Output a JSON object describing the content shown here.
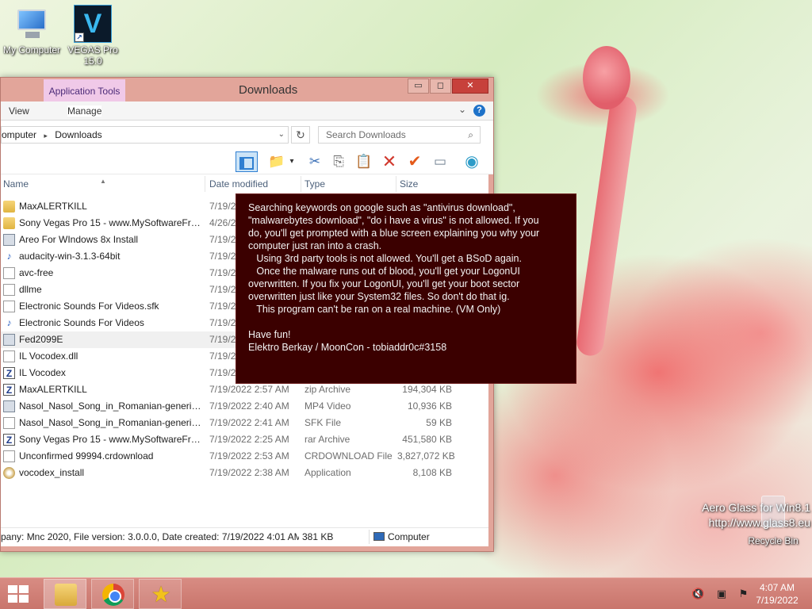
{
  "desktop": {
    "icons": [
      {
        "label": "My Computer",
        "icon": "computer-icon"
      },
      {
        "label": "VEGAS Pro 15.0",
        "icon": "vegas-pro-icon",
        "glyph": "V"
      }
    ],
    "recycle_bin": {
      "label": "Recycle Bin",
      "icon": "recycle-bin-icon"
    },
    "watermark": {
      "line1": "Aero Glass for Win8.1",
      "line2": "http://www.glass8.eu"
    }
  },
  "window": {
    "title": "Downloads",
    "contextual_tab": "Application Tools",
    "ribbon_tabs": [
      "View",
      "Manage"
    ],
    "controls": {
      "minimize": "▭",
      "maximize": "◻",
      "close": "✕"
    },
    "address": {
      "crumbs": [
        "omputer",
        "Downloads"
      ],
      "separator": "▸"
    },
    "search": {
      "placeholder": "Search Downloads"
    },
    "toolbar_icons": [
      "preview-pane-icon",
      "folder-options-icon",
      "cut-icon",
      "copy-icon",
      "paste-icon",
      "delete-icon",
      "properties-icon",
      "rename-icon",
      "globe-icon"
    ],
    "columns": {
      "name": "Name",
      "date": "Date modified",
      "type": "Type",
      "size": "Size"
    },
    "files": [
      {
        "name": "MaxALERTKILL",
        "date": "7/19/2022 2:57 AM",
        "type": "",
        "size": "",
        "icon": "folder"
      },
      {
        "name": "Sony Vegas Pro 15 - www.MySoftwareFre...",
        "date": "4/26/2022",
        "type": "",
        "size": "",
        "icon": "folder"
      },
      {
        "name": "Areo For WIndows 8x Install",
        "date": "7/19/2022",
        "type": "",
        "size": "",
        "icon": "app"
      },
      {
        "name": "audacity-win-3.1.3-64bit",
        "date": "7/19/2022",
        "type": "",
        "size": "",
        "icon": "audio"
      },
      {
        "name": "avc-free",
        "date": "7/19/2022",
        "type": "",
        "size": "",
        "icon": "file"
      },
      {
        "name": "dllme",
        "date": "7/19/2022",
        "type": "",
        "size": "",
        "icon": "file"
      },
      {
        "name": "Electronic Sounds For Videos.sfk",
        "date": "7/19/2022",
        "type": "",
        "size": "",
        "icon": "file"
      },
      {
        "name": "Electronic Sounds For Videos",
        "date": "7/19/2022",
        "type": "",
        "size": "",
        "icon": "audio"
      },
      {
        "name": "Fed2099E",
        "date": "7/19/2022",
        "type": "",
        "size": "",
        "icon": "app",
        "highlight": true
      },
      {
        "name": "IL Vocodex.dll",
        "date": "7/19/2022",
        "type": "",
        "size": "",
        "icon": "file"
      },
      {
        "name": "IL Vocodex",
        "date": "7/19/2022",
        "type": "",
        "size": "",
        "icon": "zip"
      },
      {
        "name": "MaxALERTKILL",
        "date": "7/19/2022 2:57 AM",
        "type": "zip Archive",
        "size": "194,304 KB",
        "icon": "zip"
      },
      {
        "name": "Nasol_Nasol_Song_in_Romanian-generic...",
        "date": "7/19/2022 2:40 AM",
        "type": "MP4 Video",
        "size": "10,936 KB",
        "icon": "app"
      },
      {
        "name": "Nasol_Nasol_Song_in_Romanian-generic...",
        "date": "7/19/2022 2:41 AM",
        "type": "SFK File",
        "size": "59 KB",
        "icon": "file"
      },
      {
        "name": "Sony Vegas Pro 15 - www.MySoftwareFre...",
        "date": "7/19/2022 2:25 AM",
        "type": "rar Archive",
        "size": "451,580 KB",
        "icon": "zip"
      },
      {
        "name": "Unconfirmed 99994.crdownload",
        "date": "7/19/2022 2:53 AM",
        "type": "CRDOWNLOAD File",
        "size": "3,827,072 KB",
        "icon": "file"
      },
      {
        "name": "vocodex_install",
        "date": "7/19/2022 2:38 AM",
        "type": "Application",
        "size": "8,108 KB",
        "icon": "cd"
      }
    ],
    "status": {
      "details": "pany: Mnc 2020, File version: 3.0.0.0, Date created: 7/19/2022 4:01 AM, S",
      "size": "381 KB",
      "zone": "Computer"
    }
  },
  "message": {
    "lines": [
      "Searching keywords on google such as \"antivirus download\",",
      "\"malwarebytes download\", \"do i have a virus\" is not allowed. If you",
      "do, you'll get prompted with a blue screen explaining you why your",
      "computer just ran into a crash.",
      "   Using 3rd party tools is not allowed. You'll get a BSoD again.",
      "   Once the malware runs out of blood, you'll get your LogonUI",
      "overwritten. If you fix your LogonUI, you'll get your boot sector",
      "overwritten just like your System32 files. So don't do that ig.",
      "   This program can't be ran on a real machine. (VM Only)",
      "",
      "Have fun!",
      "Elektro Berkay / MoonCon - tobiaddr0c#3158"
    ]
  },
  "taskbar": {
    "apps": [
      {
        "name": "file-explorer",
        "icon": "folder-icon"
      },
      {
        "name": "chrome",
        "icon": "chrome-icon"
      },
      {
        "name": "favorite-app",
        "icon": "star-icon"
      }
    ],
    "tray_icons": [
      "volume-muted-icon",
      "network-icon",
      "action-center-icon"
    ],
    "time": "4:07 AM",
    "date": "7/19/2022"
  }
}
